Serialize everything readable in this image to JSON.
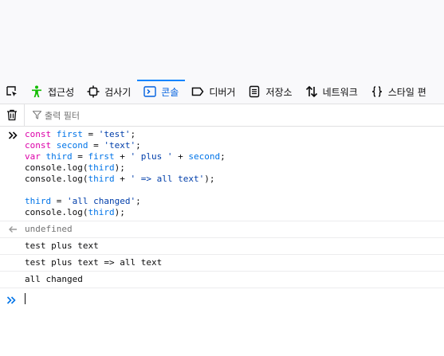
{
  "toolbar": {
    "tabs": [
      {
        "label": "접근성",
        "icon": "accessibility-icon"
      },
      {
        "label": "검사기",
        "icon": "inspector-icon"
      },
      {
        "label": "콘솔",
        "icon": "console-icon",
        "selected": true
      },
      {
        "label": "디버거",
        "icon": "debugger-icon"
      },
      {
        "label": "저장소",
        "icon": "storage-icon"
      },
      {
        "label": "네트워크",
        "icon": "network-icon"
      },
      {
        "label": "스타일 편",
        "icon": "style-editor-icon"
      }
    ]
  },
  "filter": {
    "placeholder": "출력 필터"
  },
  "console": {
    "input_lines": [
      "const first = 'test';",
      "const second = 'text';",
      "var third = first + ' plus ' + second;",
      "console.log(third);",
      "console.log(third + ' => all text');",
      "",
      "third = 'all changed';",
      "console.log(third);"
    ],
    "result": "undefined",
    "logs": [
      "test plus text",
      "test plus text => all text",
      "all changed"
    ]
  },
  "colors": {
    "accent": "#0060df",
    "keyword": "#dd00a9",
    "variable": "#0074e8",
    "string": "#003eaa"
  }
}
